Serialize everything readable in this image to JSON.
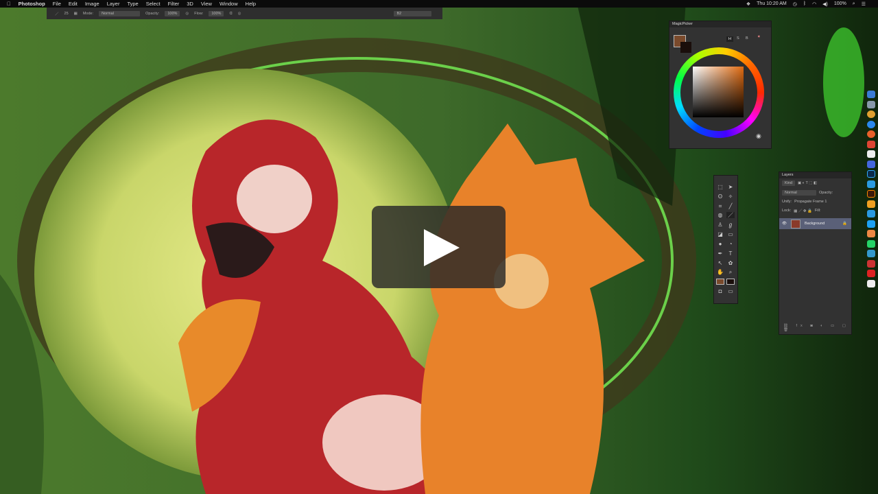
{
  "menubar": {
    "app": "Photoshop",
    "items": [
      "File",
      "Edit",
      "Image",
      "Layer",
      "Type",
      "Select",
      "Filter",
      "3D",
      "View",
      "Window",
      "Help"
    ],
    "clock": "Thu 10:20 AM",
    "battery": "100%"
  },
  "options": {
    "brush_size": "25",
    "mode_label": "Mode:",
    "mode": "Normal",
    "opacity_label": "Opacity:",
    "opacity": "100%",
    "flow_label": "Flow:",
    "flow": "100%",
    "workspace": "B2"
  },
  "magicpicker": {
    "title": "MagicPicker",
    "modes": [
      "H",
      "S",
      "B"
    ],
    "foreground": "#7a4a2c",
    "background": "#1a0e0b"
  },
  "layers": {
    "title": "Layers",
    "kind": "Kind",
    "blend": "Normal",
    "opacity_label": "Opacity:",
    "unify_label": "Unify:",
    "propagate": "Propagate Frame 1",
    "lock_label": "Lock:",
    "fill_label": "Fill:",
    "layer_name": "Background"
  },
  "video": {
    "play_label": "Play video"
  }
}
